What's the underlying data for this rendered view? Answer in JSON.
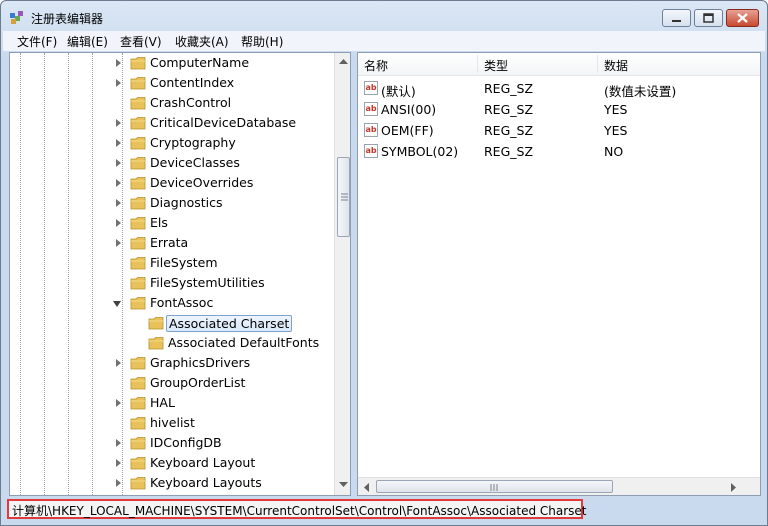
{
  "window": {
    "title": "注册表编辑器"
  },
  "menu": [
    {
      "label": "文件(F)"
    },
    {
      "label": "编辑(E)"
    },
    {
      "label": "查看(V)"
    },
    {
      "label": "收藏夹(A)"
    },
    {
      "label": "帮助(H)"
    }
  ],
  "tree": {
    "items": [
      {
        "label": "ComputerName",
        "expander": "closed",
        "level": 0
      },
      {
        "label": "ContentIndex",
        "expander": "closed",
        "level": 0
      },
      {
        "label": "CrashControl",
        "expander": "none",
        "level": 0
      },
      {
        "label": "CriticalDeviceDatabase",
        "expander": "closed",
        "level": 0
      },
      {
        "label": "Cryptography",
        "expander": "closed",
        "level": 0
      },
      {
        "label": "DeviceClasses",
        "expander": "closed",
        "level": 0
      },
      {
        "label": "DeviceOverrides",
        "expander": "closed",
        "level": 0
      },
      {
        "label": "Diagnostics",
        "expander": "closed",
        "level": 0
      },
      {
        "label": "Els",
        "expander": "closed",
        "level": 0
      },
      {
        "label": "Errata",
        "expander": "closed",
        "level": 0
      },
      {
        "label": "FileSystem",
        "expander": "none",
        "level": 0
      },
      {
        "label": "FileSystemUtilities",
        "expander": "none",
        "level": 0
      },
      {
        "label": "FontAssoc",
        "expander": "open",
        "level": 0
      },
      {
        "label": "Associated Charset",
        "expander": "none",
        "level": 1,
        "selected": true
      },
      {
        "label": "Associated DefaultFonts",
        "expander": "none",
        "level": 1
      },
      {
        "label": "GraphicsDrivers",
        "expander": "closed",
        "level": 0
      },
      {
        "label": "GroupOrderList",
        "expander": "none",
        "level": 0
      },
      {
        "label": "HAL",
        "expander": "closed",
        "level": 0
      },
      {
        "label": "hivelist",
        "expander": "none",
        "level": 0
      },
      {
        "label": "IDConfigDB",
        "expander": "closed",
        "level": 0
      },
      {
        "label": "Keyboard Layout",
        "expander": "closed",
        "level": 0
      },
      {
        "label": "Keyboard Layouts",
        "expander": "closed",
        "level": 0
      }
    ]
  },
  "values_list": {
    "columns": [
      "名称",
      "类型",
      "数据"
    ],
    "rows": [
      {
        "name": "(默认)",
        "type": "REG_SZ",
        "data": "(数值未设置)"
      },
      {
        "name": "ANSI(00)",
        "type": "REG_SZ",
        "data": "YES"
      },
      {
        "name": "OEM(FF)",
        "type": "REG_SZ",
        "data": "YES"
      },
      {
        "name": "SYMBOL(02)",
        "type": "REG_SZ",
        "data": "NO"
      }
    ],
    "icon_glyph": "ab"
  },
  "statusbar": {
    "path": "计算机\\HKEY_LOCAL_MACHINE\\SYSTEM\\CurrentControlSet\\Control\\FontAssoc\\Associated Charset"
  },
  "colors": {
    "highlight_border": "#e03a3a",
    "folder": "#e8c15a"
  }
}
